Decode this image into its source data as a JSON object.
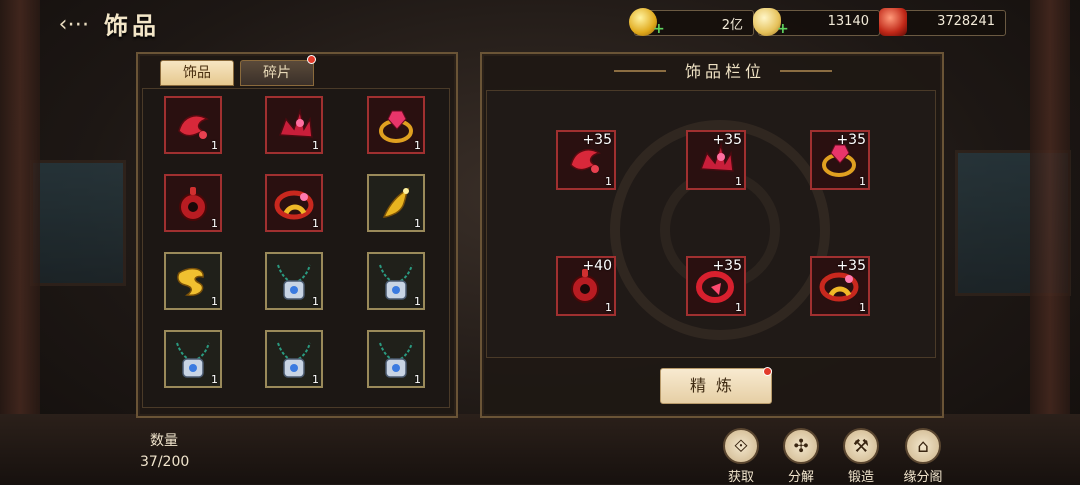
{
  "header": {
    "back_icon": "back-arrow-icon",
    "title": "饰品"
  },
  "currencies": [
    {
      "icon": "gold-coin-icon",
      "value": "2亿"
    },
    {
      "icon": "silver-ingot-icon",
      "value": "13140"
    },
    {
      "icon": "red-token-icon",
      "value": "3728241"
    }
  ],
  "tabs": [
    {
      "label": "饰品",
      "active": true
    },
    {
      "label": "碎片",
      "active": false,
      "has_notice": true
    }
  ],
  "inventory": [
    {
      "item": "red-hairpin",
      "count": "1",
      "frame": "red"
    },
    {
      "item": "red-crown",
      "count": "1",
      "frame": "red"
    },
    {
      "item": "gem-ring",
      "count": "1",
      "frame": "red"
    },
    {
      "item": "red-jade-pendant",
      "count": "1",
      "frame": "red"
    },
    {
      "item": "gold-ring",
      "count": "1",
      "frame": "red"
    },
    {
      "item": "gold-hairpin",
      "count": "1",
      "frame": "gold"
    },
    {
      "item": "gold-charm",
      "count": "1",
      "frame": "gold"
    },
    {
      "item": "silver-necklace",
      "count": "1",
      "frame": "gold"
    },
    {
      "item": "silver-necklace",
      "count": "1",
      "frame": "gold"
    },
    {
      "item": "silver-necklace",
      "count": "1",
      "frame": "gold"
    },
    {
      "item": "silver-necklace",
      "count": "1",
      "frame": "gold"
    },
    {
      "item": "silver-necklace",
      "count": "1",
      "frame": "gold"
    }
  ],
  "equip_panel": {
    "title": "饰品栏位",
    "slots": [
      {
        "item": "red-hairpin",
        "plus": "+35",
        "count": "1"
      },
      {
        "item": "red-crown",
        "plus": "+35",
        "count": "1"
      },
      {
        "item": "gem-ring",
        "plus": "+35",
        "count": "1"
      },
      {
        "item": "red-jade-pendant",
        "plus": "+40",
        "count": "1"
      },
      {
        "item": "red-bracelet",
        "plus": "+35",
        "count": "1"
      },
      {
        "item": "gold-ring",
        "plus": "+35",
        "count": "1"
      }
    ],
    "refine_label": "精炼",
    "refine_has_notice": true
  },
  "quantity": {
    "label": "数量",
    "value": "37/200"
  },
  "actions": [
    {
      "label": "获取",
      "icon": "obtain-icon"
    },
    {
      "label": "分解",
      "icon": "decompose-icon"
    },
    {
      "label": "锻造",
      "icon": "forge-hammer-icon"
    },
    {
      "label": "缘分阁",
      "icon": "pavilion-icon"
    }
  ],
  "colors": {
    "slot_red": "#a03030",
    "slot_gold": "#9a8a5a",
    "accent": "#e6c98f",
    "notice": "#e23b2b"
  }
}
